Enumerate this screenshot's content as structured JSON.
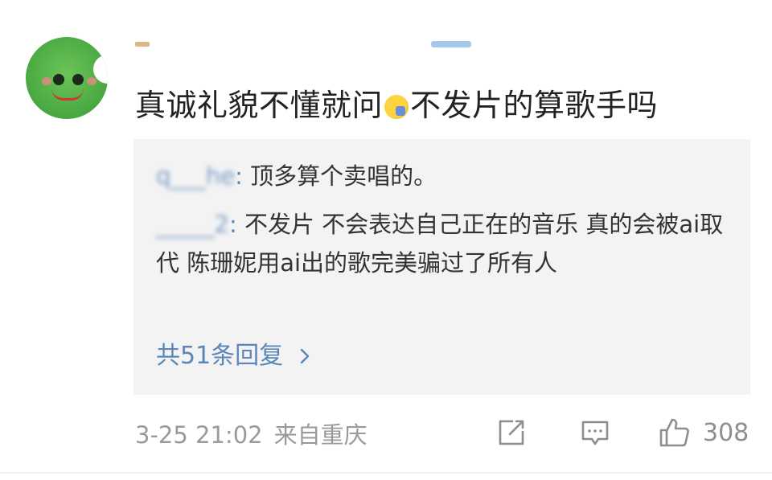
{
  "comment": {
    "text_before_emoji": "真诚礼貌不懂就问",
    "emoji": "raising-hand-emoji",
    "text_after_emoji": "不发片的算歌手吗",
    "time": "3-25 21:02",
    "location": "来自重庆",
    "like_count": "308"
  },
  "replies": [
    {
      "name": "q___he",
      "name_blurred": true,
      "colon": ":",
      "text": " 顶多算个卖唱的。"
    },
    {
      "name": "_____2",
      "name_blurred": true,
      "colon": ":",
      "text": " 不发片 不会表达自己正在的音乐 真的会被ai取代 陈珊妮用ai出的歌完美骗过了所有人"
    }
  ],
  "more_replies_label": "共51条回复",
  "colors": {
    "link": "#5b86ba",
    "reply_bg": "#f3f3f3",
    "meta": "#9a9a9a"
  }
}
